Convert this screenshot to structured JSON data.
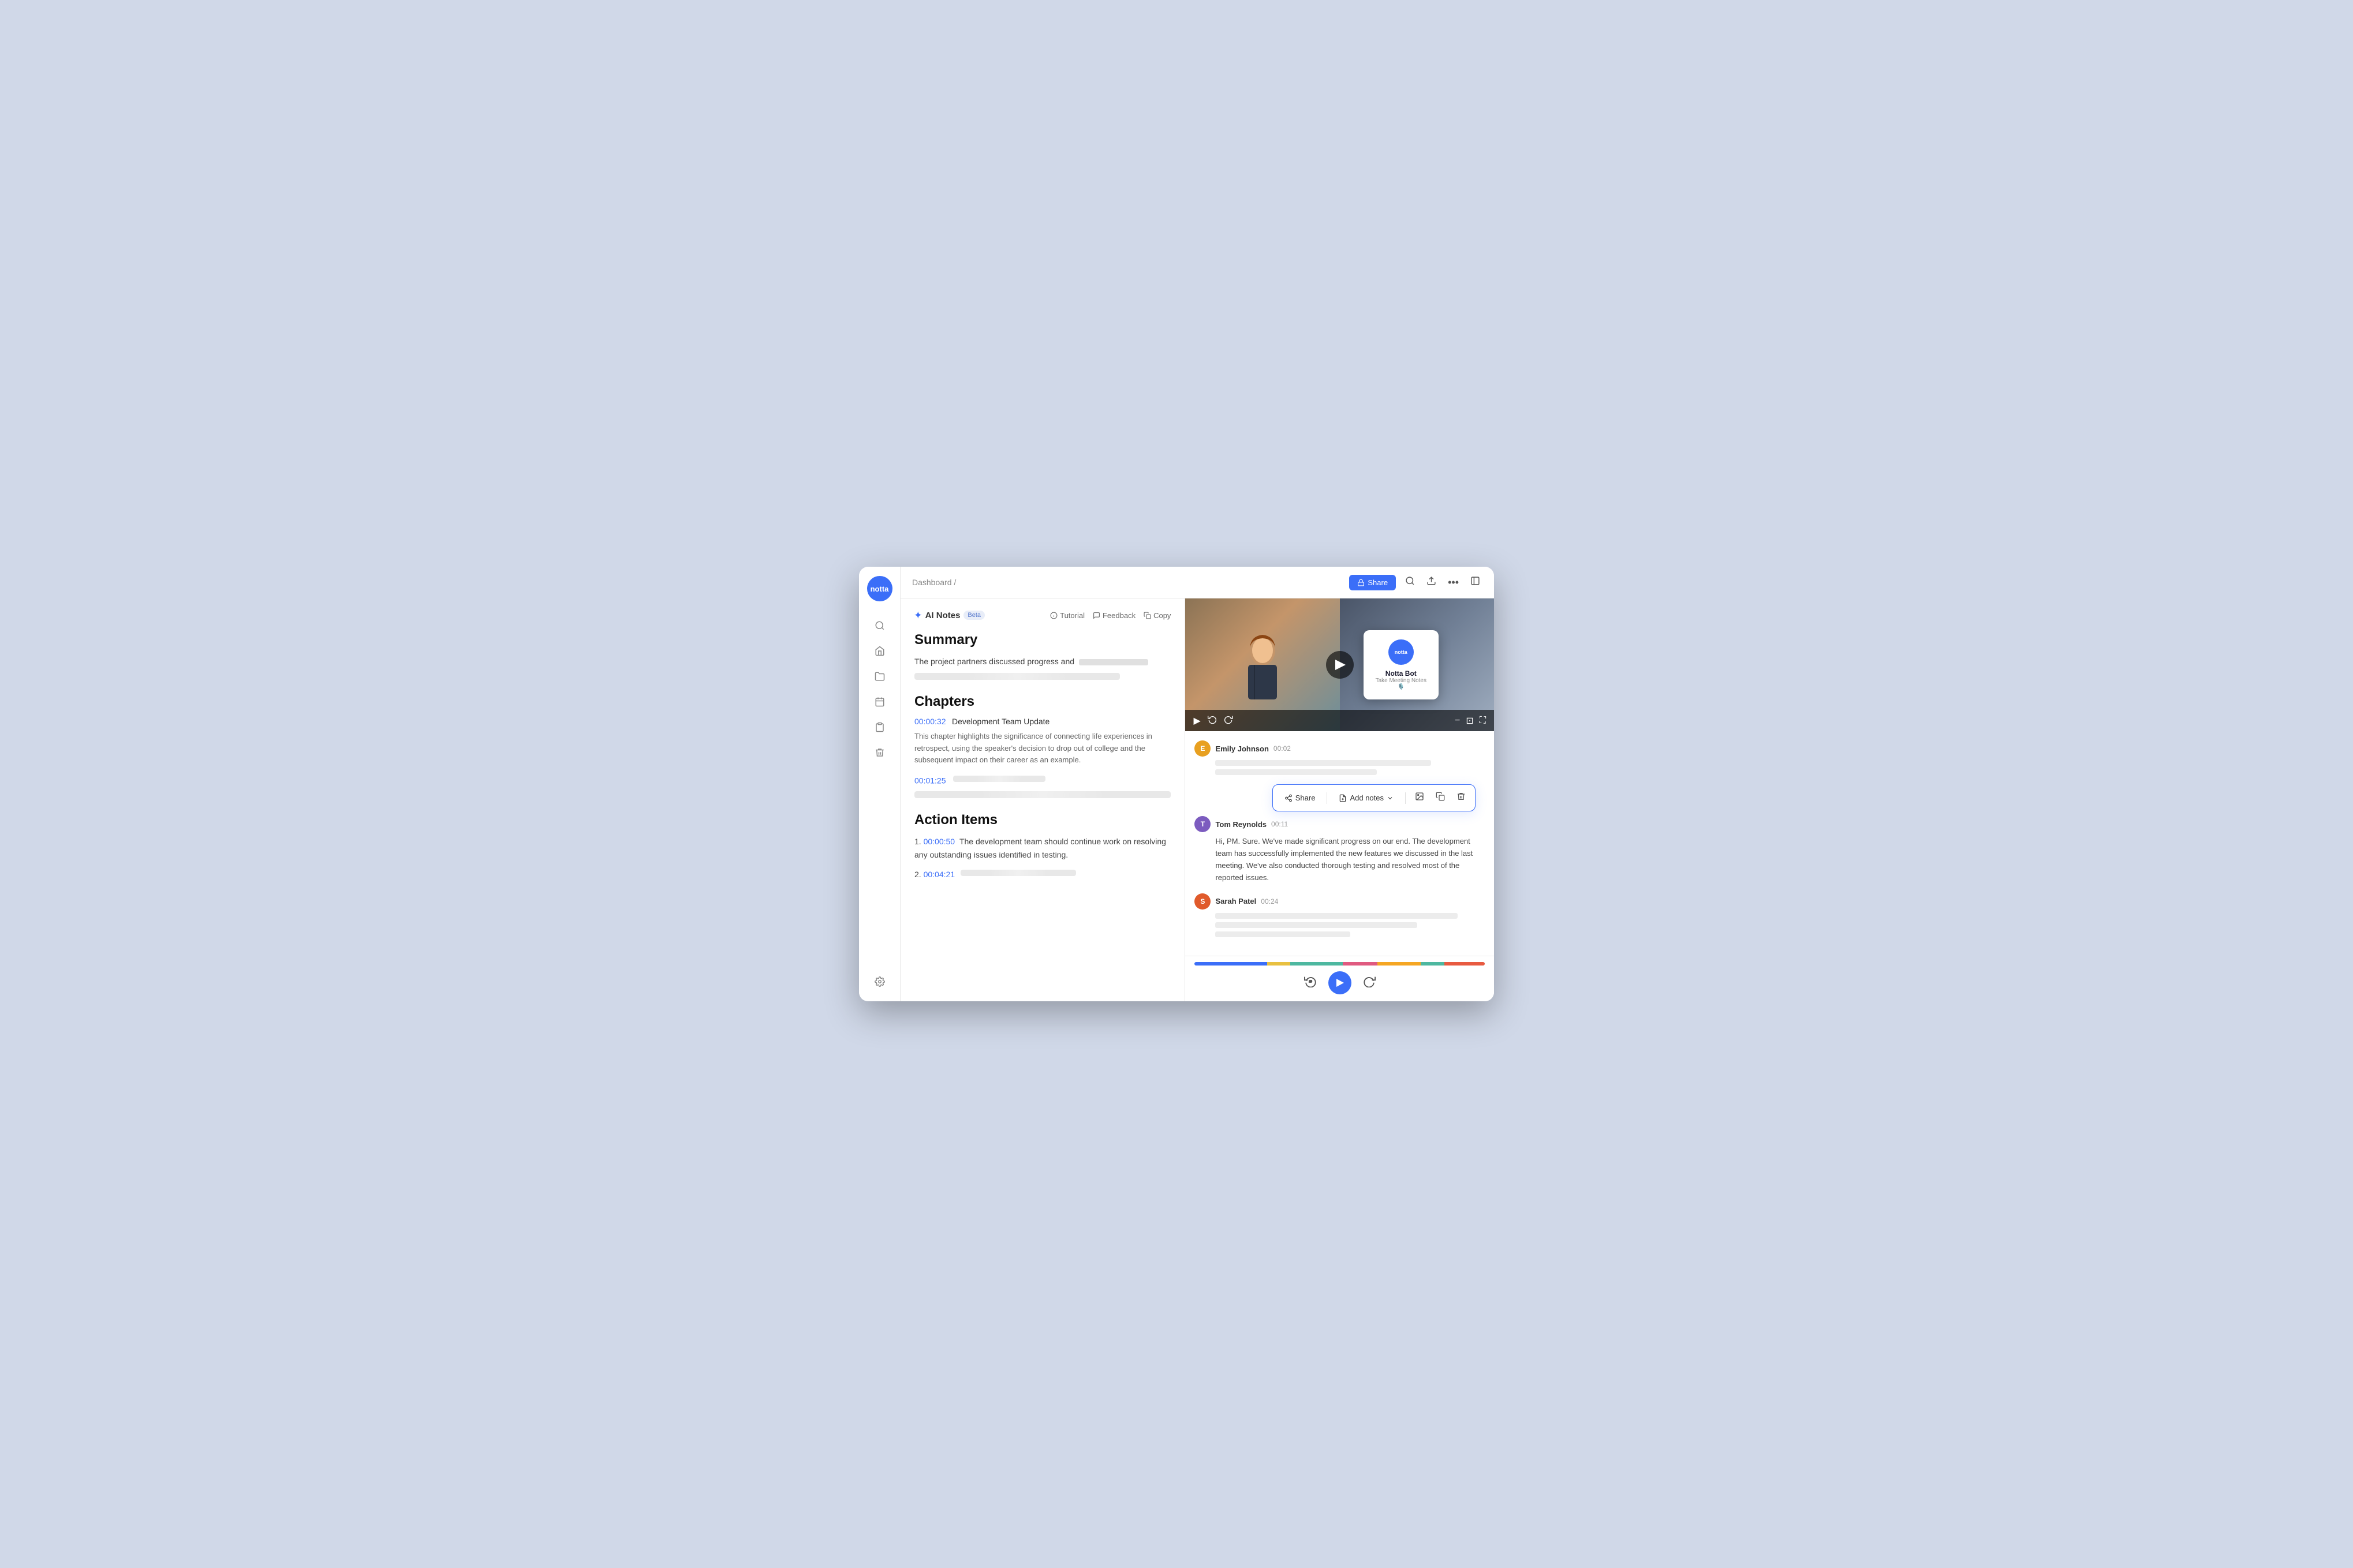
{
  "sidebar": {
    "logo_text": "notta",
    "icons": [
      "search",
      "home",
      "folder",
      "calendar",
      "clipboard",
      "trash"
    ],
    "bottom_icon": "settings"
  },
  "header": {
    "breadcrumb": "Dashboard /",
    "share_label": "Share",
    "icons": [
      "search",
      "upload",
      "more",
      "sidebar"
    ]
  },
  "ai_notes": {
    "title": "AI Notes",
    "beta_label": "Beta",
    "tutorial_label": "Tutorial",
    "feedback_label": "Feedback",
    "copy_label": "Copy",
    "summary_heading": "Summary",
    "summary_text": "The  project partners discussed progress and",
    "chapters_heading": "Chapters",
    "chapter1": {
      "timestamp": "00:00:32",
      "title": "Development Team Update",
      "description": "This chapter highlights the significance of connecting life experiences in retrospect, using the speaker's decision to drop out of college and the subsequent impact on their career as an example."
    },
    "chapter2": {
      "timestamp": "00:01:25"
    },
    "action_items_heading": "Action Items",
    "action1": {
      "number": "1.",
      "timestamp": "00:00:50",
      "text": "The development team should continue work on resolving any outstanding issues identified in testing."
    },
    "action2": {
      "number": "2.",
      "timestamp": "00:04:21"
    }
  },
  "video": {
    "notta_bot_name": "Notta Bot",
    "notta_bot_sub": "Take Meeting Notes 🎙️",
    "notta_logo": "notta"
  },
  "transcript": {
    "entries": [
      {
        "speaker": "Emily Johnson",
        "time": "00:02",
        "initial": "E",
        "color": "#e8a020"
      },
      {
        "speaker": "Tom Reynolds",
        "time": "00:11",
        "initial": "T",
        "color": "#7c5cbf",
        "text": "Hi, PM. Sure. We've made significant progress on our end. The development team has successfully implemented the new features we discussed in the last meeting. We've also conducted thorough testing and resolved most of the reported issues."
      },
      {
        "speaker": "Sarah Patel",
        "time": "00:24",
        "initial": "S",
        "color": "#e05a2b"
      }
    ]
  },
  "toolbar": {
    "share_label": "Share",
    "add_notes_label": "Add notes",
    "dropdown_icon": "chevron-down"
  },
  "progress": {
    "segments": [
      {
        "color": "#3b6ef8",
        "width": "25%"
      },
      {
        "color": "#e8c040",
        "width": "8%"
      },
      {
        "color": "#4db8a0",
        "width": "18%"
      },
      {
        "color": "#e05a80",
        "width": "12%"
      },
      {
        "color": "#f5a623",
        "width": "15%"
      },
      {
        "color": "#4db8a0",
        "width": "8%"
      },
      {
        "color": "#e85a40",
        "width": "14%"
      }
    ]
  }
}
